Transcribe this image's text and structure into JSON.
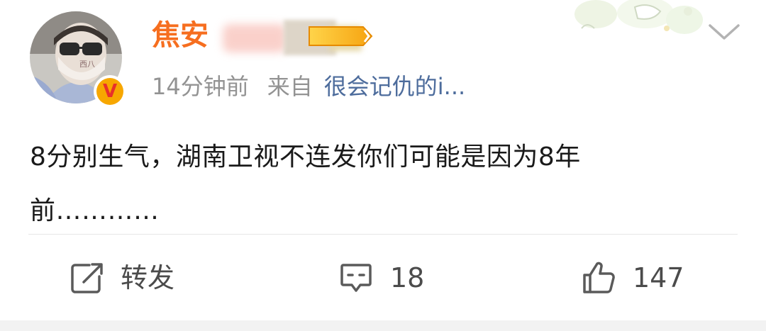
{
  "post": {
    "author": {
      "name": "焦安",
      "avatar_text": "西八"
    },
    "time": "14分钟前",
    "from_label": "来自",
    "source": "很会记仇的i...",
    "content": {
      "line1": "8分别生气，湖南卫视不连发你们可能是因为8年",
      "line2": "前…………"
    }
  },
  "actions": {
    "repost_label": "转发",
    "comment_count": "18",
    "like_count": "147"
  },
  "colors": {
    "username": "#f66e1f",
    "source_link": "#4d6c9c",
    "meta_text": "#939393",
    "vip_badge": "#f7a700"
  }
}
